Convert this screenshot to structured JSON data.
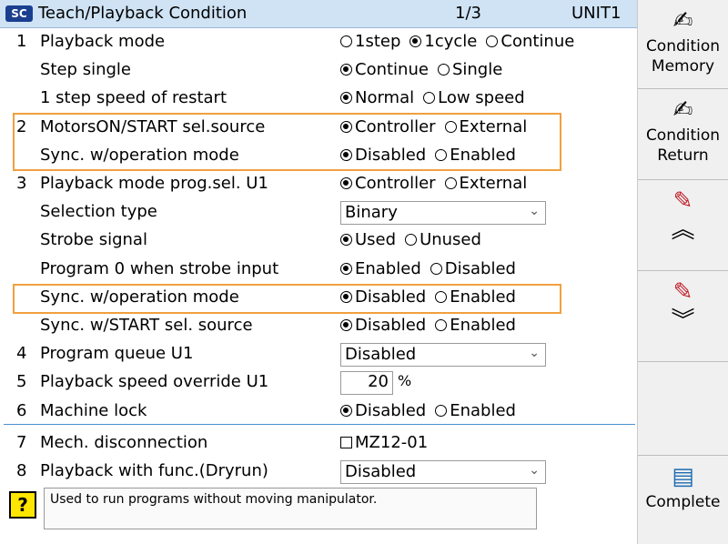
{
  "title": {
    "logo": "SC",
    "text": "Teach/Playback Condition",
    "page": "1/3",
    "unit": "UNIT1"
  },
  "rows": [
    {
      "num": "1",
      "label": "Playback mode",
      "options": [
        {
          "label": "1step",
          "on": false
        },
        {
          "label": "1cycle",
          "on": true
        },
        {
          "label": "Continue",
          "on": false
        }
      ]
    },
    {
      "num": "",
      "label": "Step single",
      "options": [
        {
          "label": "Continue",
          "on": true
        },
        {
          "label": "Single",
          "on": false
        }
      ]
    },
    {
      "num": "",
      "label": "1 step speed of restart",
      "options": [
        {
          "label": "Normal",
          "on": true
        },
        {
          "label": "Low speed",
          "on": false
        }
      ]
    },
    {
      "num": "2",
      "label": "MotorsON/START sel.source",
      "options": [
        {
          "label": "Controller",
          "on": true
        },
        {
          "label": "External",
          "on": false
        }
      ]
    },
    {
      "num": "",
      "label": "Sync. w/operation mode",
      "options": [
        {
          "label": "Disabled",
          "on": true
        },
        {
          "label": "Enabled",
          "on": false
        }
      ]
    },
    {
      "num": "3",
      "label": "Playback mode prog.sel. U1",
      "options": [
        {
          "label": "Controller",
          "on": true
        },
        {
          "label": "External",
          "on": false
        }
      ]
    },
    {
      "num": "",
      "label": "Selection type",
      "select": "Binary"
    },
    {
      "num": "",
      "label": "Strobe signal",
      "options": [
        {
          "label": "Used",
          "on": true
        },
        {
          "label": "Unused",
          "on": false
        }
      ]
    },
    {
      "num": "",
      "label": "Program 0 when strobe input",
      "options": [
        {
          "label": "Enabled",
          "on": true
        },
        {
          "label": "Disabled",
          "on": false
        }
      ]
    },
    {
      "num": "",
      "label": "Sync. w/operation mode",
      "options": [
        {
          "label": "Disabled",
          "on": true
        },
        {
          "label": "Enabled",
          "on": false
        }
      ]
    },
    {
      "num": "",
      "label": "Sync. w/START sel. source",
      "options": [
        {
          "label": "Disabled",
          "on": true
        },
        {
          "label": "Enabled",
          "on": false
        }
      ]
    },
    {
      "num": "4",
      "label": "Program queue U1",
      "select": "Disabled"
    },
    {
      "num": "5",
      "label": "Playback speed override U1",
      "number": "20",
      "unit": "%"
    },
    {
      "num": "6",
      "label": "Machine lock",
      "options": [
        {
          "label": "Disabled",
          "on": true
        },
        {
          "label": "Enabled",
          "on": false
        }
      ]
    },
    {
      "num": "7",
      "label": "Mech. disconnection",
      "checkbox": "MZ12-01"
    },
    {
      "num": "8",
      "label": "Playback with func.(Dryrun)",
      "select": "Disabled"
    }
  ],
  "help": {
    "icon": "?",
    "message": "Used to run programs without moving manipulator."
  },
  "side": {
    "cond_memory": [
      "Condition",
      "Memory"
    ],
    "cond_return": [
      "Condition",
      "Return"
    ],
    "complete": "Complete"
  },
  "colors": {
    "highlight": "#f0a040",
    "titlebar": "#cfe3f5",
    "divider": "#4d8fd0"
  }
}
